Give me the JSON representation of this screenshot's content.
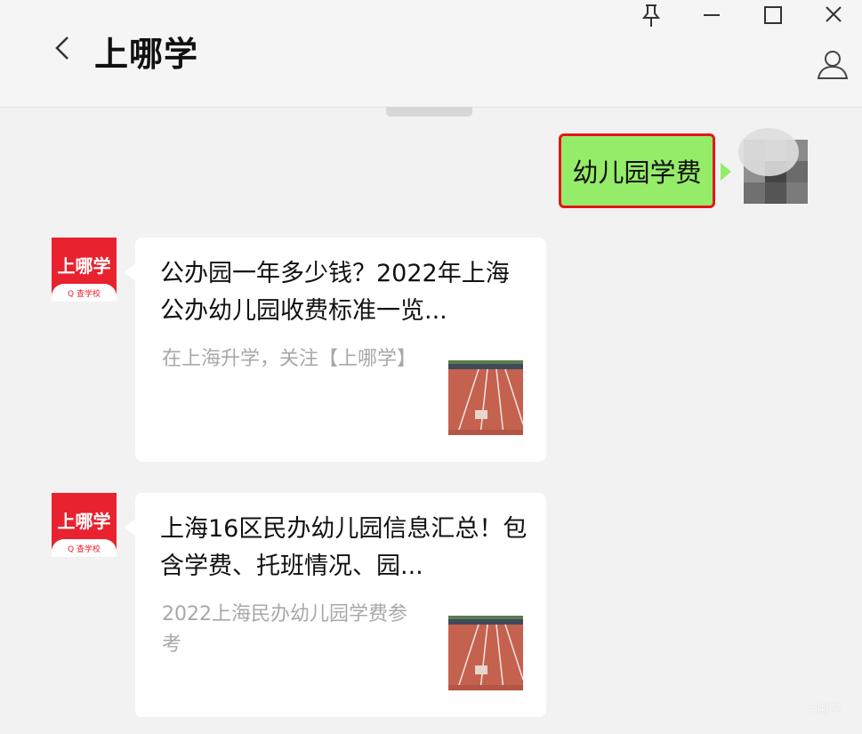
{
  "window": {
    "title": "上哪学",
    "controls": [
      "pin-icon",
      "minimize-icon",
      "maximize-icon",
      "close-icon"
    ]
  },
  "header": {
    "back_icon": "chevron-left-icon",
    "profile_icon": "person-icon"
  },
  "messages": [
    {
      "from": "me",
      "type": "text",
      "text": "幼儿园学费"
    },
    {
      "from": "account",
      "type": "article",
      "avatar_text": "上哪学",
      "avatar_sub": "Q 查学校",
      "title": "公办园一年多少钱？2022年上海公办幼儿园收费标准一览...",
      "description": "在上海升学，关注【上哪学】"
    },
    {
      "from": "account",
      "type": "article",
      "avatar_text": "上哪学",
      "avatar_sub": "Q 查学校",
      "title": "上海16区民办幼儿园信息汇总！包含学费、托班情况、园...",
      "description": "2022上海民办幼儿园学费参考"
    }
  ],
  "watermark": "上哪学",
  "colors": {
    "brand_red": "#e8222e",
    "my_bubble": "#95ec69",
    "highlight_border": "#e5151a",
    "background": "#f2f2f2"
  }
}
